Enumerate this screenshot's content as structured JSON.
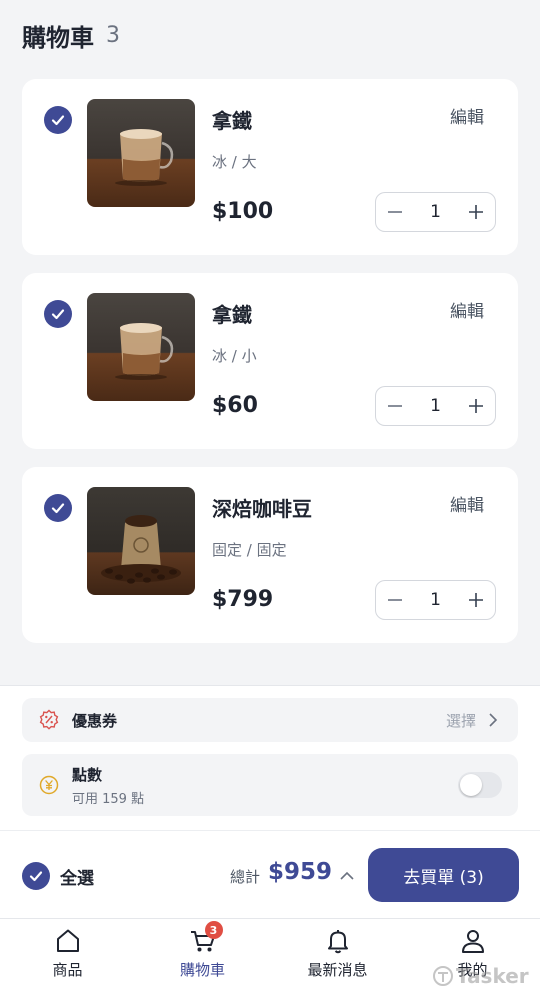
{
  "header": {
    "title": "購物車",
    "count": "3"
  },
  "cart": {
    "items": [
      {
        "name": "拿鐵",
        "variant": "冰 / 大",
        "price": "$100",
        "quantity": "1",
        "edit_label": "編輯",
        "image": "latte-cup",
        "checked": true
      },
      {
        "name": "拿鐵",
        "variant": "冰 / 小",
        "price": "$60",
        "quantity": "1",
        "edit_label": "編輯",
        "image": "latte-cup",
        "checked": true
      },
      {
        "name": "深焙咖啡豆",
        "variant": "固定 / 固定",
        "price": "$799",
        "quantity": "1",
        "edit_label": "編輯",
        "image": "coffee-bean-sack",
        "checked": true
      }
    ]
  },
  "coupon": {
    "label": "優惠券",
    "action": "選擇",
    "icon": "coupon-badge-icon"
  },
  "points": {
    "label": "點數",
    "available": "可用 159 點",
    "icon": "yen-coin-icon",
    "toggle_on": false
  },
  "checkout": {
    "select_all_label": "全選",
    "total_label": "總計",
    "total_value": "$959",
    "buy_button": "去買單 (3)"
  },
  "tabbar": {
    "items": [
      {
        "label": "商品",
        "icon": "home-icon",
        "active": false
      },
      {
        "label": "購物車",
        "icon": "cart-icon",
        "active": true,
        "badge": "3"
      },
      {
        "label": "最新消息",
        "icon": "bell-icon",
        "active": false
      },
      {
        "label": "我的",
        "icon": "user-icon",
        "active": false
      }
    ]
  },
  "watermark": "Tasker",
  "colors": {
    "primary": "#3f4a95",
    "badge": "#e04e43",
    "background": "#f3f4f6"
  }
}
